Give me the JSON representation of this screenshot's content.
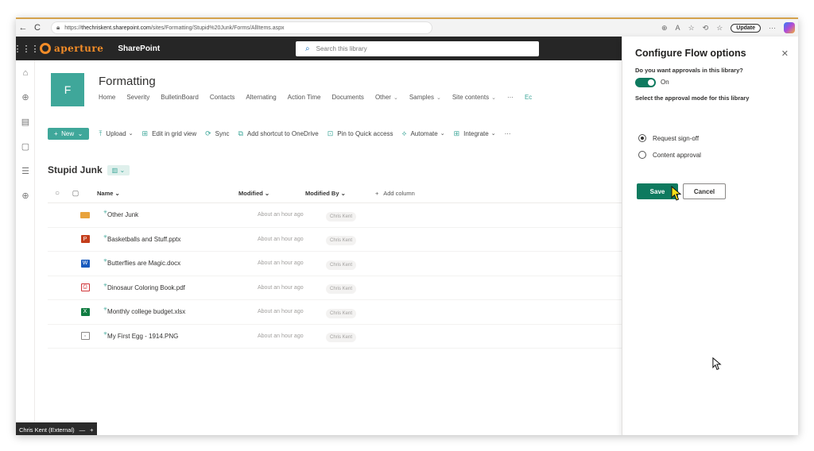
{
  "browser": {
    "url_prefix": "https://",
    "url_host": "thechriskent.sharepoint.com",
    "url_path": "/sites/Formatting/Stupid%20Junk/Forms/AllItems.aspx",
    "update_label": "Update"
  },
  "suite": {
    "brand": "aperture",
    "app_name": "SharePoint",
    "search_placeholder": "Search this library"
  },
  "site": {
    "logo_letter": "F",
    "title": "Formatting",
    "nav": [
      {
        "label": "Home",
        "chevron": false
      },
      {
        "label": "Severity",
        "chevron": false
      },
      {
        "label": "BulletinBoard",
        "chevron": false
      },
      {
        "label": "Contacts",
        "chevron": false
      },
      {
        "label": "Alternating",
        "chevron": false
      },
      {
        "label": "Action Time",
        "chevron": false
      },
      {
        "label": "Documents",
        "chevron": false
      },
      {
        "label": "Other",
        "chevron": true
      },
      {
        "label": "Samples",
        "chevron": true
      },
      {
        "label": "Site contents",
        "chevron": true
      },
      {
        "label": "···",
        "chevron": false
      },
      {
        "label": "Ec",
        "chevron": false
      }
    ]
  },
  "commands": {
    "new": "New",
    "upload": "Upload",
    "edit_grid": "Edit in grid view",
    "sync": "Sync",
    "add_shortcut": "Add shortcut to OneDrive",
    "pin": "Pin to Quick access",
    "automate": "Automate",
    "integrate": "Integrate",
    "more": "···"
  },
  "library": {
    "title": "Stupid Junk",
    "columns": {
      "name": "Name",
      "modified": "Modified",
      "modified_by": "Modified By",
      "add": "Add column"
    },
    "rows": [
      {
        "name": "Other Junk",
        "modified": "About an hour ago",
        "modified_by": "Chris Kent",
        "type": "folder",
        "color": "#e8a33d"
      },
      {
        "name": "Basketballs and Stuff.pptx",
        "modified": "About an hour ago",
        "modified_by": "Chris Kent",
        "type": "pptx",
        "color": "#c43e1c"
      },
      {
        "name": "Butterflies are Magic.docx",
        "modified": "About an hour ago",
        "modified_by": "Chris Kent",
        "type": "docx",
        "color": "#185abd"
      },
      {
        "name": "Dinosaur Coloring Book.pdf",
        "modified": "About an hour ago",
        "modified_by": "Chris Kent",
        "type": "pdf",
        "color": "#d13438"
      },
      {
        "name": "Monthly college budget.xlsx",
        "modified": "About an hour ago",
        "modified_by": "Chris Kent",
        "type": "xlsx",
        "color": "#107c41"
      },
      {
        "name": "My First Egg - 1914.PNG",
        "modified": "About an hour ago",
        "modified_by": "Chris Kent",
        "type": "png",
        "color": "#8a8886"
      }
    ]
  },
  "statusbar": {
    "user": "Chris Kent (External)",
    "dash": "—",
    "plus": "+"
  },
  "pane": {
    "title": "Configure Flow options",
    "question1": "Do you want approvals in this library?",
    "toggle_label": "On",
    "question2": "Select the approval mode for this library",
    "options": [
      {
        "label": "Request sign-off",
        "selected": true
      },
      {
        "label": "Content approval",
        "selected": false
      }
    ],
    "save": "Save",
    "cancel": "Cancel"
  },
  "colors": {
    "accent": "#3fa79a",
    "primary_button": "#0e7a5f",
    "brand": "#f28c28"
  }
}
